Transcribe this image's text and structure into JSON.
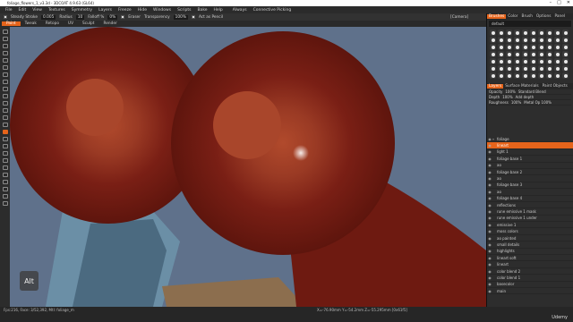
{
  "titlebar": {
    "title": "foliage_flowers_1_v3.3d - 3DCOAT 4.9.63 (GL64)"
  },
  "menubar": {
    "items": [
      "File",
      "Edit",
      "View",
      "Textures",
      "Symmetry",
      "Layers",
      "Freeze",
      "Hide",
      "Windows",
      "Scripts",
      "Bake",
      "Help"
    ],
    "always": "Always",
    "connective": "Connective Picking"
  },
  "tool_options": {
    "steady_stroke": "Steady Stroke",
    "stroke_val": "0.005",
    "radius": "Radius",
    "radius_val": "10",
    "falloff": "Falloff %",
    "falloff_val": "0%",
    "eraser": "Eraser",
    "transparency": "Transparency",
    "transparency_val": "100%",
    "act_as_pencil": "Act as Pencil",
    "camera": "[Camera]"
  },
  "mode_tabs": [
    "Paint",
    "Tweak",
    "Retopo",
    "UV",
    "Sculpt",
    "Render"
  ],
  "right_panel": {
    "brush_tabs": [
      "Brushes",
      "Color",
      "Brush",
      "Options",
      "Panel"
    ],
    "preset": "default",
    "layer_tabs": [
      "Layers",
      "Surface Materials",
      "Paint Objects"
    ],
    "props": [
      {
        "label": "Opacity",
        "val": "100%",
        "extra": "Standard Blend"
      },
      {
        "label": "Depth",
        "val": "100%",
        "extra": "Add depth"
      },
      {
        "label": "Roughness",
        "val": "100%",
        "extra": "Metal Op 100%"
      }
    ],
    "layers": [
      {
        "name": "foliage",
        "selected": false
      },
      {
        "name": "lineart",
        "selected": true
      },
      {
        "name": "light 1",
        "selected": false
      },
      {
        "name": "foliage base 1",
        "selected": false
      },
      {
        "name": "ao",
        "selected": false
      },
      {
        "name": "foliage base 2",
        "selected": false
      },
      {
        "name": "ao",
        "selected": false
      },
      {
        "name": "foliage base 3",
        "selected": false
      },
      {
        "name": "ao",
        "selected": false
      },
      {
        "name": "foliage base 4",
        "selected": false
      },
      {
        "name": "reflections",
        "selected": false
      },
      {
        "name": "rune emissive 1 mask",
        "selected": false
      },
      {
        "name": "rune emissive 1 under",
        "selected": false
      },
      {
        "name": "emissive 1",
        "selected": false
      },
      {
        "name": "moss colors",
        "selected": false
      },
      {
        "name": "ao painted",
        "selected": false
      },
      {
        "name": "small details",
        "selected": false
      },
      {
        "name": "highlights",
        "selected": false
      },
      {
        "name": "lineart soft",
        "selected": false
      },
      {
        "name": "lineart",
        "selected": false
      },
      {
        "name": "color blend 2",
        "selected": false
      },
      {
        "name": "color blend 1",
        "selected": false
      },
      {
        "name": "basecolor",
        "selected": false
      },
      {
        "name": "main",
        "selected": false
      }
    ]
  },
  "status": {
    "text": "Fps:216,  Face: 3/52,392,  Mtl: foliage_m",
    "coords": "X=-76.90mm  Y=-54.2mm  Z=-55.295mm  [0x61f5]"
  },
  "overlay": {
    "alt": "Alt",
    "watermark": "Udemy"
  },
  "colors": {
    "accent": "#e5641b",
    "viewport_bg": "#5f718b",
    "foliage": "#7b1c12"
  }
}
